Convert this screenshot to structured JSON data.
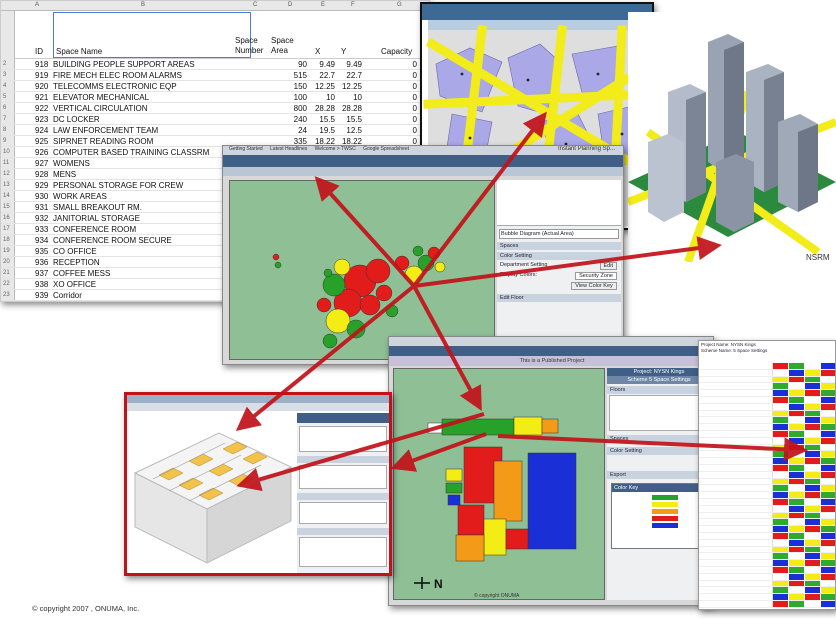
{
  "spreadsheet": {
    "column_letters": [
      "A",
      "B",
      "C",
      "D",
      "E",
      "F",
      "G"
    ],
    "headers": {
      "id": "ID",
      "name": "Space Name",
      "number": "Space Number",
      "area": "Space Area",
      "x": "X",
      "y": "Y",
      "capacity": "Capacity"
    },
    "rows": [
      {
        "rn": "2",
        "id": "918",
        "name": "BUILDING PEOPLE SUPPORT AREAS",
        "area": "90",
        "x": "9.49",
        "y": "9.49",
        "cap": "0"
      },
      {
        "rn": "3",
        "id": "919",
        "name": "FIRE MECH ELEC ROOM ALARMS",
        "area": "515",
        "x": "22.7",
        "y": "22.7",
        "cap": "0"
      },
      {
        "rn": "4",
        "id": "920",
        "name": "TELECOMMS ELECTRONIC EQP",
        "area": "150",
        "x": "12.25",
        "y": "12.25",
        "cap": "0"
      },
      {
        "rn": "5",
        "id": "921",
        "name": "ELEVATOR MECHANICAL",
        "area": "100",
        "x": "10",
        "y": "10",
        "cap": "0"
      },
      {
        "rn": "6",
        "id": "922",
        "name": "VERTICAL CIRCULATION",
        "area": "800",
        "x": "28.28",
        "y": "28.28",
        "cap": "0"
      },
      {
        "rn": "7",
        "id": "923",
        "name": "DC LOCKER",
        "area": "240",
        "x": "15.5",
        "y": "15.5",
        "cap": "0"
      },
      {
        "rn": "8",
        "id": "924",
        "name": "LAW ENFORCEMENT TEAM",
        "area": "24",
        "x": "19.5",
        "y": "12.5",
        "cap": "0"
      },
      {
        "rn": "9",
        "id": "925",
        "name": "SIPRNET READING ROOM",
        "area": "335",
        "x": "18.22",
        "y": "18.22",
        "cap": "0"
      },
      {
        "rn": "10",
        "id": "926",
        "name": "COMPUTER BASED TRAINING CLASSRM",
        "area": "",
        "x": "",
        "y": "",
        "cap": ""
      },
      {
        "rn": "11",
        "id": "927",
        "name": "WOMENS",
        "area": "",
        "x": "",
        "y": "",
        "cap": ""
      },
      {
        "rn": "12",
        "id": "928",
        "name": "MENS",
        "area": "",
        "x": "",
        "y": "",
        "cap": ""
      },
      {
        "rn": "13",
        "id": "929",
        "name": "PERSONAL STORAGE FOR CREW",
        "area": "",
        "x": "",
        "y": "",
        "cap": ""
      },
      {
        "rn": "14",
        "id": "930",
        "name": "WORK AREAS",
        "area": "",
        "x": "",
        "y": "",
        "cap": ""
      },
      {
        "rn": "15",
        "id": "931",
        "name": "SMALL BREAKOUT RM.",
        "area": "",
        "x": "",
        "y": "",
        "cap": ""
      },
      {
        "rn": "16",
        "id": "932",
        "name": "JANITORIAL STORAGE",
        "area": "",
        "x": "",
        "y": "",
        "cap": ""
      },
      {
        "rn": "17",
        "id": "933",
        "name": "CONFERENCE ROOM",
        "area": "",
        "x": "",
        "y": "",
        "cap": ""
      },
      {
        "rn": "18",
        "id": "934",
        "name": "CONFERENCE ROOM SECURE",
        "area": "",
        "x": "",
        "y": "",
        "cap": ""
      },
      {
        "rn": "19",
        "id": "935",
        "name": "CO OFFICE",
        "area": "",
        "x": "",
        "y": "",
        "cap": ""
      },
      {
        "rn": "20",
        "id": "936",
        "name": "RECEPTION",
        "area": "",
        "x": "",
        "y": "",
        "cap": ""
      },
      {
        "rn": "21",
        "id": "937",
        "name": "COFFEE MESS",
        "area": "",
        "x": "",
        "y": "",
        "cap": ""
      },
      {
        "rn": "22",
        "id": "938",
        "name": "XO OFFICE",
        "area": "",
        "x": "",
        "y": "",
        "cap": ""
      },
      {
        "rn": "23",
        "id": "939",
        "name": "Corridor",
        "area": "",
        "x": "",
        "y": "",
        "cap": ""
      }
    ]
  },
  "bubble_screen": {
    "tabs": [
      "Getting Started",
      "Latest Headlines",
      "Welcome > TWSC",
      "Google Spreadsheet"
    ],
    "heading": "Instant Planning Sp...",
    "panel_items": [
      "Bubble Diagram (Actual Area)",
      "Spaces",
      "Color Setting",
      "Department Setting",
      "Display Colors:",
      "Security Zone",
      "View Color Key",
      "Edit Floor"
    ],
    "edit_label": "Edit",
    "colors": {
      "bg": "#8fbf95",
      "red": "#e21b1b",
      "green": "#27a12a",
      "yellow": "#f3ec15"
    }
  },
  "floor_screen": {
    "banner": "This is a Published Project",
    "project": "Project: NYSN Kings",
    "settings": "Scheme 5 Space Settings",
    "footer": "© copyright ONUMA",
    "panel_items": [
      "Floors",
      "Spaces",
      "Color Setting",
      "Export",
      "Color Key"
    ],
    "compass": "N",
    "colors": {
      "bg": "#8fbf95",
      "blue": "#1a2fd6",
      "orange": "#f39a18",
      "red": "#e21b1b",
      "yellow": "#f3ec15",
      "green": "#27a12a"
    }
  },
  "color_table": {
    "title": "Project Name: NYSN Kings",
    "subtitle": "Scheme Name: 5 Space Settings",
    "colors": {
      "red": "#e21b1b",
      "blue": "#1a2fd6",
      "green": "#2faa2f",
      "yellow": "#f3ec15"
    }
  },
  "red_screen": {
    "frame_color": "#c1121a"
  },
  "copyright": "© copyright 2007 , ONUMA, Inc."
}
